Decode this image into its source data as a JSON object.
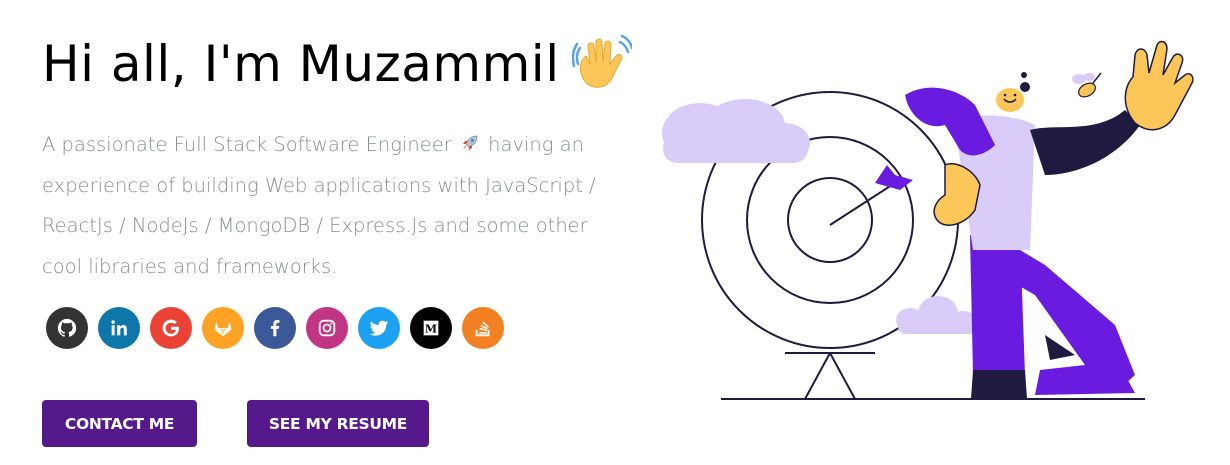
{
  "greeting": {
    "title": "Hi all, I'm Muzammil",
    "wave_icon": "waving-hand-icon"
  },
  "subtitle": {
    "before_rocket": "A passionate Full Stack Software Engineer",
    "rocket_icon": "rocket-icon",
    "after_rocket": "having an experience of building Web applications with JavaScript / ReactJs / NodeJs / MongoDB / Express.Js and some other cool libraries and frameworks."
  },
  "socials": [
    {
      "name": "github",
      "icon": "github-icon",
      "color": "#333333"
    },
    {
      "name": "linkedin",
      "icon": "linkedin-icon",
      "color": "#0e76a8"
    },
    {
      "name": "google",
      "icon": "google-icon",
      "color": "#ea4335",
      "glyph": "G"
    },
    {
      "name": "gitlab",
      "icon": "gitlab-icon",
      "color": "#fca326"
    },
    {
      "name": "facebook",
      "icon": "facebook-icon",
      "color": "#3b5998",
      "glyph": "f"
    },
    {
      "name": "instagram",
      "icon": "instagram-icon",
      "color": "#c13584"
    },
    {
      "name": "twitter",
      "icon": "twitter-icon",
      "color": "#1da1f2"
    },
    {
      "name": "medium",
      "icon": "medium-icon",
      "color": "#000000",
      "glyph": "M"
    },
    {
      "name": "stackoverflow",
      "icon": "stackoverflow-icon",
      "color": "#f48024"
    }
  ],
  "buttons": {
    "contact": "CONTACT ME",
    "resume": "SEE MY RESUME"
  },
  "colors": {
    "accent": "#55198b",
    "subtitle": "#868e96",
    "illustration_purple": "#6c2bd9",
    "illustration_lavender": "#d9ccf8",
    "illustration_yellow": "#fcc659"
  }
}
